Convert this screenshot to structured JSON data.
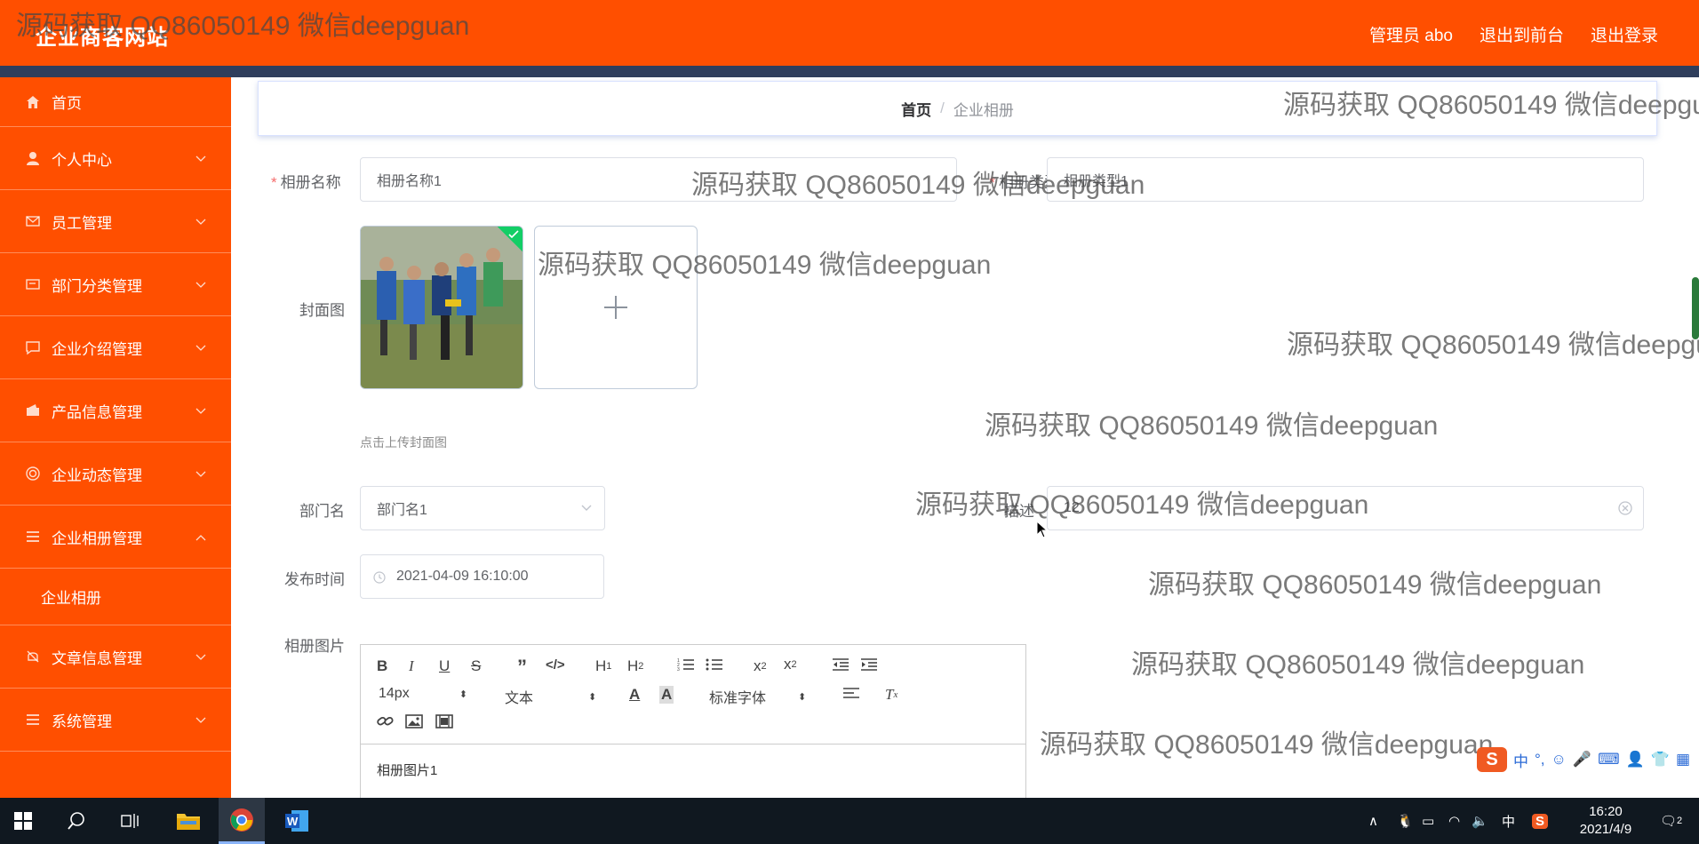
{
  "app": {
    "logo": "企业商客网站",
    "top_links": [
      "管理员 abo",
      "退出到前台",
      "退出登录"
    ]
  },
  "sidebar": {
    "items": [
      {
        "label": "首页",
        "icon": "home-icon",
        "expandable": false
      },
      {
        "label": "个人中心",
        "icon": "user-icon",
        "expandable": true
      },
      {
        "label": "员工管理",
        "icon": "mail-icon",
        "expandable": true
      },
      {
        "label": "部门分类管理",
        "icon": "card-icon",
        "expandable": true
      },
      {
        "label": "企业介绍管理",
        "icon": "chat-icon",
        "expandable": true
      },
      {
        "label": "产品信息管理",
        "icon": "wallet-icon",
        "expandable": true
      },
      {
        "label": "企业动态管理",
        "icon": "target-icon",
        "expandable": true
      },
      {
        "label": "企业相册管理",
        "icon": "menu-icon",
        "expandable": true,
        "open": true
      },
      {
        "label": "文章信息管理",
        "icon": "bell-icon",
        "expandable": true
      },
      {
        "label": "系统管理",
        "icon": "menu-icon",
        "expandable": true
      }
    ],
    "sub_item": "企业相册"
  },
  "breadcrumb": {
    "home": "首页",
    "separator": "/",
    "current": "企业相册"
  },
  "form": {
    "album_name_label": "相册名称",
    "album_name_value": "相册名称1",
    "album_type_label": "相册类型",
    "album_type_value": "相册类型1",
    "cover_label": "封面图",
    "cover_hint": "点击上传封面图",
    "dept_label": "部门名",
    "dept_value": "部门名1",
    "desc_label": "描述",
    "desc_value": "12",
    "time_label": "发布时间",
    "time_value": "2021-04-09 16:10:00",
    "images_label": "相册图片",
    "editor_content": "相册图片1"
  },
  "editor_toolbar": {
    "font_size": "14px",
    "text_style": "文本",
    "font_family": "标准字体"
  },
  "watermark": "源码获取 QQ86050149 微信deepguan",
  "ime": {
    "lang": "中",
    "punct": "°,"
  },
  "taskbar": {
    "tray_lang": "中",
    "time": "16:20",
    "date": "2021/4/9",
    "notifications": "2"
  },
  "colors": {
    "primary": "#ff4f00",
    "accent_bar": "#2f3e5c",
    "taskbar": "#101820"
  }
}
